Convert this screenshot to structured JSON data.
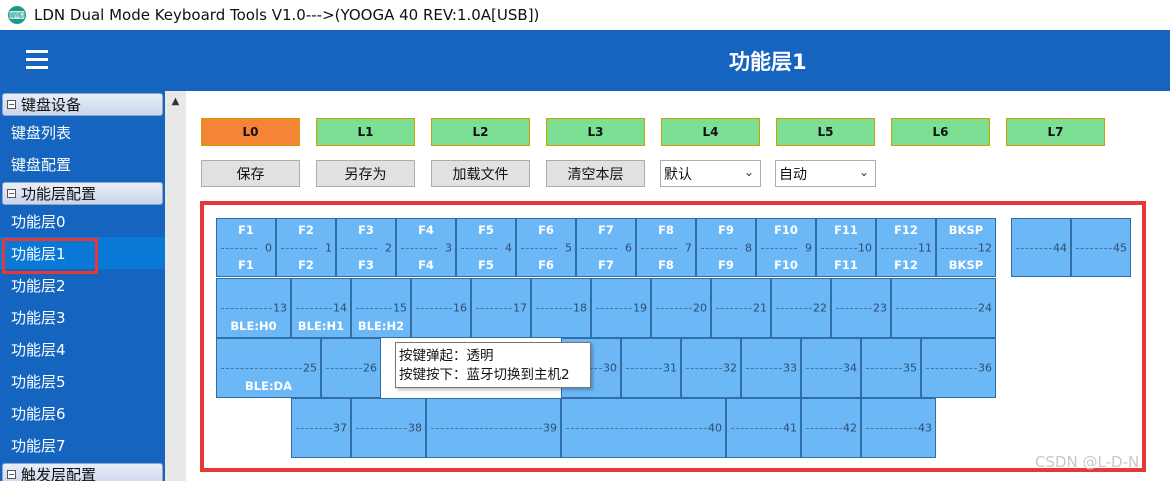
{
  "window": {
    "title": "LDN Dual Mode Keyboard Tools V1.0--->(YOOGA 40 REV:1.0A[USB])"
  },
  "header": {
    "title": "功能层1"
  },
  "sidebar": {
    "groups": [
      {
        "label": "键盘设备",
        "items": [
          "键盘列表",
          "键盘配置"
        ]
      },
      {
        "label": "功能层配置",
        "items": [
          "功能层0",
          "功能层1",
          "功能层2",
          "功能层3",
          "功能层4",
          "功能层5",
          "功能层6",
          "功能层7"
        ]
      },
      {
        "label": "触发层配置"
      }
    ],
    "active_item": "功能层1"
  },
  "layers": [
    "L0",
    "L1",
    "L2",
    "L3",
    "L4",
    "L5",
    "L6",
    "L7"
  ],
  "active_layer": "L0",
  "actions": {
    "save": "保存",
    "save_as": "另存为",
    "load": "加载文件",
    "clear": "清空本层"
  },
  "selects": {
    "mode1": "默认",
    "mode2": "自动"
  },
  "keys": {
    "k0": {
      "top": "F1",
      "bottom": "F1",
      "index": "0"
    },
    "k1": {
      "top": "F2",
      "bottom": "F2",
      "index": "1"
    },
    "k2": {
      "top": "F3",
      "bottom": "F3",
      "index": "2"
    },
    "k3": {
      "top": "F4",
      "bottom": "F4",
      "index": "3"
    },
    "k4": {
      "top": "F5",
      "bottom": "F5",
      "index": "4"
    },
    "k5": {
      "top": "F6",
      "bottom": "F6",
      "index": "5"
    },
    "k6": {
      "top": "F7",
      "bottom": "F7",
      "index": "6"
    },
    "k7": {
      "top": "F8",
      "bottom": "F8",
      "index": "7"
    },
    "k8": {
      "top": "F9",
      "bottom": "F9",
      "index": "8"
    },
    "k9": {
      "top": "F10",
      "bottom": "F10",
      "index": "9"
    },
    "k10": {
      "top": "F11",
      "bottom": "F11",
      "index": "10"
    },
    "k11": {
      "top": "F12",
      "bottom": "F12",
      "index": "11"
    },
    "k12": {
      "top": "BKSP",
      "bottom": "BKSP",
      "index": "12"
    },
    "k44": {
      "index": "44"
    },
    "k45": {
      "index": "45"
    },
    "k13": {
      "bottom": "BLE:H0",
      "index": "13"
    },
    "k14": {
      "bottom": "BLE:H1",
      "index": "14"
    },
    "k15": {
      "bottom": "BLE:H2",
      "index": "15"
    },
    "k16": {
      "index": "16"
    },
    "k17": {
      "index": "17"
    },
    "k18": {
      "index": "18"
    },
    "k19": {
      "index": "19"
    },
    "k20": {
      "index": "20"
    },
    "k21": {
      "index": "21"
    },
    "k22": {
      "index": "22"
    },
    "k23": {
      "index": "23"
    },
    "k24": {
      "index": "24"
    },
    "k25": {
      "bottom": "BLE:DA",
      "index": "25"
    },
    "k26": {
      "index": "26"
    },
    "k30": {
      "index": "30"
    },
    "k31": {
      "index": "31"
    },
    "k32": {
      "index": "32"
    },
    "k33": {
      "index": "33"
    },
    "k34": {
      "index": "34"
    },
    "k35": {
      "index": "35"
    },
    "k36": {
      "index": "36"
    },
    "k37": {
      "index": "37"
    },
    "k38": {
      "index": "38"
    },
    "k39": {
      "index": "39"
    },
    "k40": {
      "index": "40"
    },
    "k41": {
      "index": "41"
    },
    "k42": {
      "index": "42"
    },
    "k43": {
      "index": "43"
    }
  },
  "tooltip": {
    "line1": "按键弹起：透明",
    "line2": "按键按下：蓝牙切换到主机2"
  },
  "watermark": "CSDN @L-D-N",
  "colors": {
    "header": "#1565c0",
    "active_layer": "#f58436",
    "layer": "#7ddf94",
    "key": "#6cb7f5",
    "highlight": "#e53935"
  }
}
